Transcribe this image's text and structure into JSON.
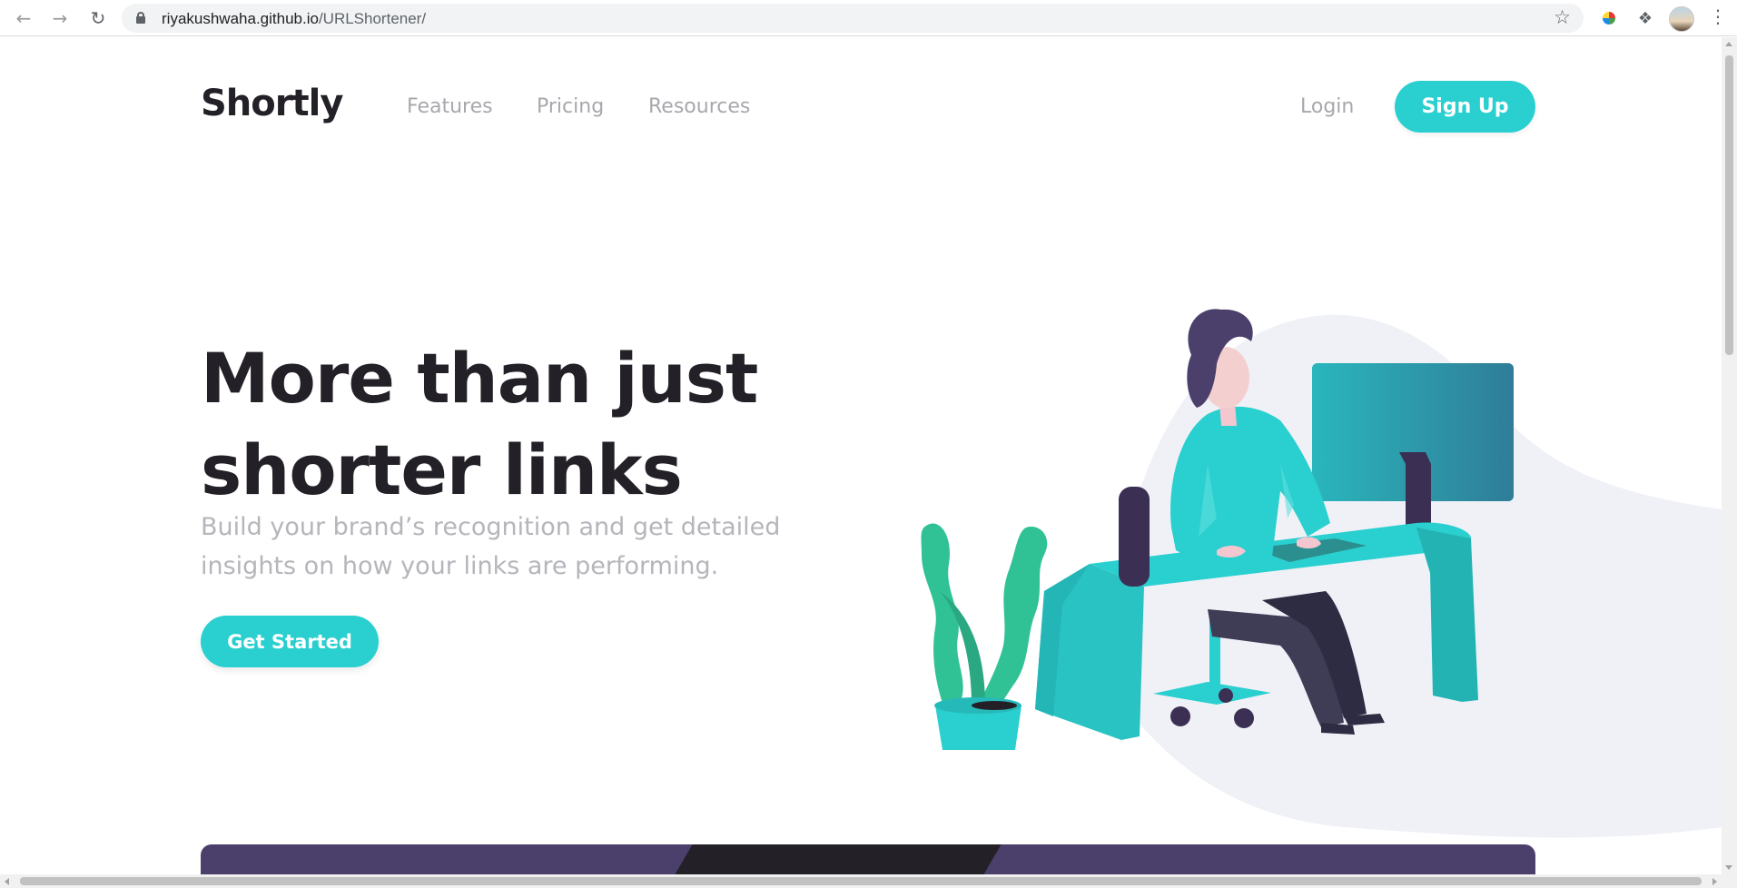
{
  "browser": {
    "url_domain": "riyakushwaha.github.io",
    "url_path": "/URLShortener/",
    "icons": [
      "back-icon",
      "forward-icon",
      "reload-icon",
      "lock-icon",
      "star-icon",
      "puzzle-icon",
      "kebab-menu-icon"
    ]
  },
  "header": {
    "logo": "Shortly",
    "nav": {
      "features": "Features",
      "pricing": "Pricing",
      "resources": "Resources"
    },
    "login": "Login",
    "signup": "Sign Up"
  },
  "hero": {
    "title_line1": "More than just",
    "title_line2": "shorter links",
    "subtitle_line1": "Build your brand’s recognition and get detailed",
    "subtitle_line2": "insights on how your links are performing.",
    "cta": "Get Started"
  },
  "colors": {
    "accent": "#2acfcf",
    "dark_violet": "#3b3054",
    "very_dark_blue": "#232127",
    "gray": "#bfbfbf",
    "band_violet": "#4b3f6b"
  }
}
